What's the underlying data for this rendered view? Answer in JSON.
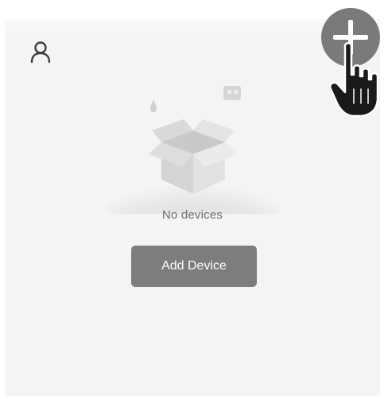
{
  "header": {
    "profile_icon": "user-icon",
    "add_icon": "plus-icon"
  },
  "empty_state": {
    "illustration_icon": "empty-box-icon",
    "message": "No devices",
    "add_device_label": "Add Device"
  },
  "overlay": {
    "cursor_icon": "hand-pointer-icon"
  },
  "colors": {
    "screen_background": "#f4f4f4",
    "button_background": "#7d7d7d",
    "button_text": "#ffffff",
    "message_text": "#6b6b6b",
    "add_button_background": "#7a7a7a"
  }
}
